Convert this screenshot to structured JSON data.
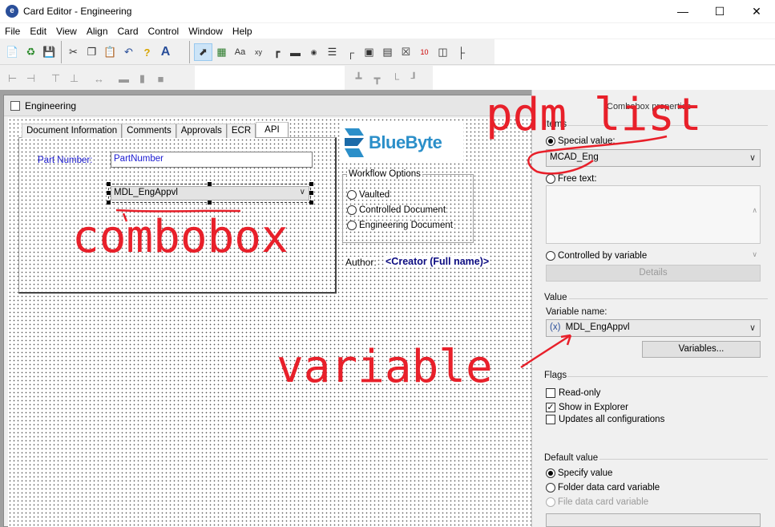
{
  "window": {
    "title": "Card Editor - Engineering",
    "icon": "card-editor-icon"
  },
  "menu": [
    "File",
    "Edit",
    "View",
    "Align",
    "Card",
    "Control",
    "Window",
    "Help"
  ],
  "card_window": {
    "title": "Engineering"
  },
  "tabs": [
    "Document Information",
    "Comments",
    "Approvals",
    "ECR",
    "API"
  ],
  "form": {
    "part_number_label": "Part Number:",
    "part_number_value": "PartNumber",
    "combo_value": "MDL_EngAppvl",
    "logo_text": "BlueByte",
    "workflow_legend": "Workflow Options",
    "workflow_options": [
      "Vaulted",
      "Controlled Document",
      "Engineering Document"
    ],
    "author_label": "Author:",
    "author_value": "<Creator (Full name)>"
  },
  "properties": {
    "title": "Combobox properties",
    "items_label": "Items",
    "special_value_label": "Special value:",
    "special_value": "MCAD_Eng",
    "free_text_label": "Free text:",
    "controlled_by_variable_label": "Controlled by variable",
    "details_button": "Details",
    "value_label": "Value",
    "variable_name_label": "Variable name:",
    "variable_prefix": "(x)",
    "variable_name": "MDL_EngAppvl",
    "variables_button": "Variables...",
    "flags_label": "Flags",
    "flags": [
      {
        "label": "Read-only",
        "checked": false
      },
      {
        "label": "Show in Explorer",
        "checked": true
      },
      {
        "label": "Updates all configurations",
        "checked": false
      }
    ],
    "default_value_label": "Default value",
    "default_options": [
      {
        "label": "Specify value",
        "selected": true,
        "enabled": true
      },
      {
        "label": "Folder data card variable",
        "selected": false,
        "enabled": true
      },
      {
        "label": "File data card variable",
        "selected": false,
        "enabled": false
      }
    ]
  },
  "annotations": {
    "pdm_list": "pdm list",
    "combobox": "combobox",
    "variable": "variable",
    "color": "#e8202a"
  },
  "colors": {
    "label_blue": "#1b1bd0",
    "author_navy": "#0b0b80",
    "logo_blue": "#2b8fc9"
  }
}
